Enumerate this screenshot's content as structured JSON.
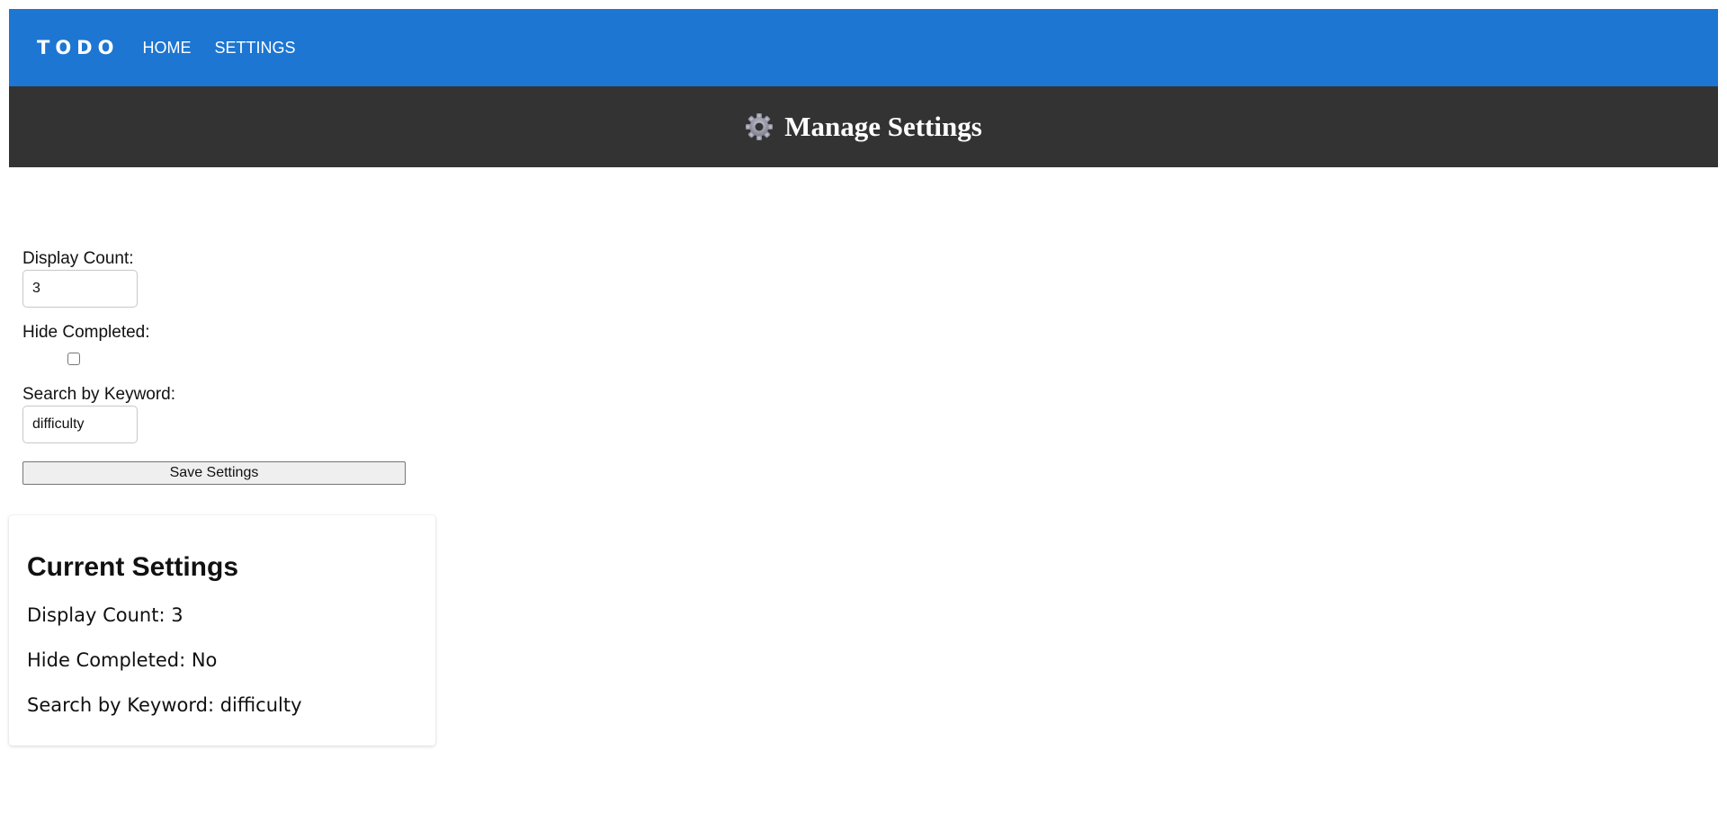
{
  "navbar": {
    "brand": "TODO",
    "links": [
      "HOME",
      "SETTINGS"
    ],
    "color": "#1c76d2"
  },
  "banner": {
    "icon": "gear-icon",
    "title": "Manage Settings",
    "color": "#333333"
  },
  "form": {
    "display_count_label": "Display Count:",
    "display_count_value": "3",
    "hide_completed_label": "Hide Completed:",
    "hide_completed_checked": false,
    "keyword_label": "Search by Keyword:",
    "keyword_value": "difficulty",
    "save_label": "Save Settings"
  },
  "current": {
    "title": "Current Settings",
    "display_count": "Display Count: 3",
    "hide_completed": "Hide Completed: No",
    "keyword": "Search by Keyword: difficulty"
  }
}
